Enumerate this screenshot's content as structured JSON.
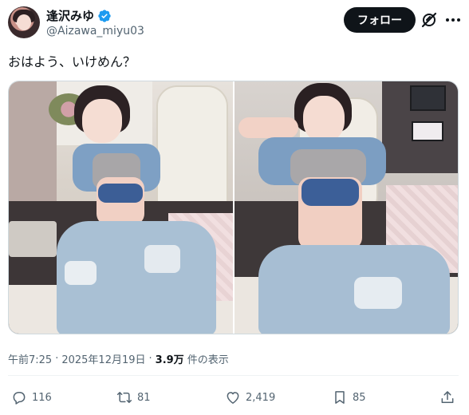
{
  "user": {
    "display_name": "逢沢みゆ",
    "handle": "@Aizawa_miyu03",
    "verified": true
  },
  "follow_button": {
    "label": "フォロー"
  },
  "tweet": {
    "text": "おはよう、いけめん？"
  },
  "media": {
    "count": 2,
    "items": [
      {
        "kind": "photo"
      },
      {
        "kind": "photo"
      }
    ]
  },
  "meta": {
    "time": "午前7:25",
    "separator1": "·",
    "date": "2025年12月19日",
    "separator2": "·",
    "views_count": "3.9万",
    "views_label": "件の表示"
  },
  "actions": {
    "replies": "116",
    "reposts": "81",
    "likes": "2,419",
    "bookmarks": "85"
  },
  "colors": {
    "text_primary": "#0f1419",
    "text_secondary": "#536471",
    "verified": "#1d9bf0",
    "follow_bg": "#0f1419",
    "divider": "#eff3f4"
  },
  "icons": {
    "verified": "verified-badge-icon",
    "grok": "grok-icon",
    "more": "more-icon",
    "reply": "reply-icon",
    "repost": "repost-icon",
    "like": "heart-icon",
    "bookmark": "bookmark-icon",
    "share": "share-icon"
  }
}
